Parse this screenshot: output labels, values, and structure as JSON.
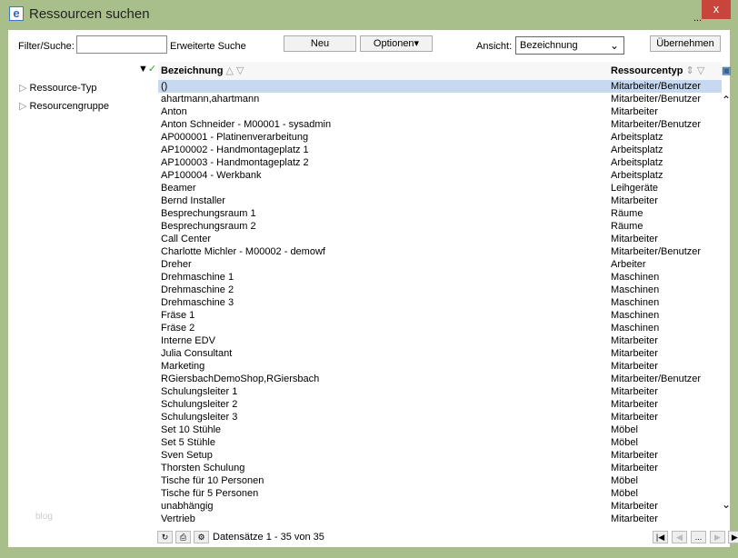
{
  "window": {
    "title": "Ressourcen suchen",
    "close": "x",
    "more": "..."
  },
  "toolbar": {
    "filter_label": "Filter/Suche:",
    "filter_value": "",
    "extended_search": "Erweiterte Suche",
    "new": "Neu",
    "options": "Optionen▾",
    "view_label": "Ansicht:",
    "view_value": "Bezeichnung",
    "apply": "Übernehmen"
  },
  "tree": [
    "Ressource-Typ",
    "Resourcengruppe"
  ],
  "columns": [
    "Bezeichnung",
    "Ressourcentyp"
  ],
  "rows": [
    [
      "()",
      "Mitarbeiter/Benutzer"
    ],
    [
      "ahartmann,ahartmann",
      "Mitarbeiter/Benutzer"
    ],
    [
      "Anton",
      "Mitarbeiter"
    ],
    [
      "Anton Schneider - M00001 - sysadmin",
      "Mitarbeiter/Benutzer"
    ],
    [
      "AP000001 - Platinenverarbeitung",
      "Arbeitsplatz"
    ],
    [
      "AP100002 - Handmontageplatz 1",
      "Arbeitsplatz"
    ],
    [
      "AP100003 - Handmontageplatz 2",
      "Arbeitsplatz"
    ],
    [
      "AP100004 - Werkbank",
      "Arbeitsplatz"
    ],
    [
      "Beamer",
      "Leihgeräte"
    ],
    [
      "Bernd Installer",
      "Mitarbeiter"
    ],
    [
      "Besprechungsraum 1",
      "Räume"
    ],
    [
      "Besprechungsraum 2",
      "Räume"
    ],
    [
      "Call Center",
      "Mitarbeiter"
    ],
    [
      "Charlotte Michler - M00002 - demowf",
      "Mitarbeiter/Benutzer"
    ],
    [
      "Dreher",
      "Arbeiter"
    ],
    [
      "Drehmaschine 1",
      "Maschinen"
    ],
    [
      "Drehmaschine 2",
      "Maschinen"
    ],
    [
      "Drehmaschine 3",
      "Maschinen"
    ],
    [
      "Fräse 1",
      "Maschinen"
    ],
    [
      "Fräse 2",
      "Maschinen"
    ],
    [
      "Interne EDV",
      "Mitarbeiter"
    ],
    [
      "Julia Consultant",
      "Mitarbeiter"
    ],
    [
      "Marketing",
      "Mitarbeiter"
    ],
    [
      "RGiersbachDemoShop,RGiersbach",
      "Mitarbeiter/Benutzer"
    ],
    [
      "Schulungsleiter 1",
      "Mitarbeiter"
    ],
    [
      "Schulungsleiter 2",
      "Mitarbeiter"
    ],
    [
      "Schulungsleiter 3",
      "Mitarbeiter"
    ],
    [
      "Set 10 Stühle",
      "Möbel"
    ],
    [
      "Set 5 Stühle",
      "Möbel"
    ],
    [
      "Sven Setup",
      "Mitarbeiter"
    ],
    [
      "Thorsten Schulung",
      "Mitarbeiter"
    ],
    [
      "Tische für 10 Personen",
      "Möbel"
    ],
    [
      "Tische für 5 Personen",
      "Möbel"
    ],
    [
      "unabhängig",
      "Mitarbeiter"
    ],
    [
      "Vertrieb",
      "Mitarbeiter"
    ]
  ],
  "footer": {
    "records": "Datensätze 1 - 35 von 35",
    "page": "..."
  },
  "watermark": "blog"
}
